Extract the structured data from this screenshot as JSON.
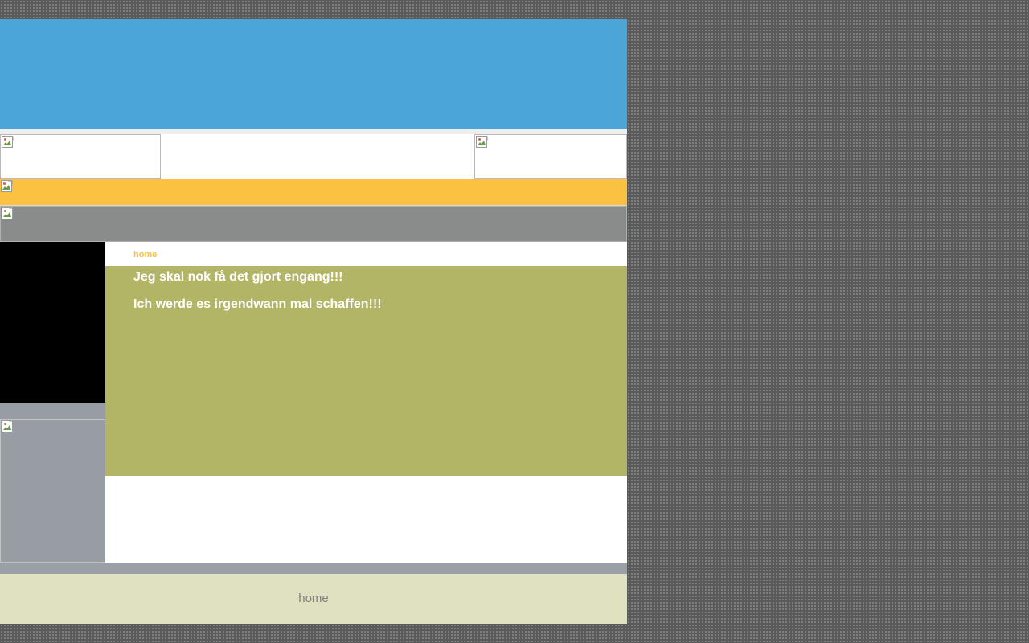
{
  "breadcrumb": {
    "label": "home"
  },
  "content": {
    "line_1": "Jeg skal nok få det gjort engang!!!",
    "line_2": "Ich werde es irgendwann mal schaffen!!!"
  },
  "footer": {
    "link_label": "home"
  },
  "icons": {
    "broken_image": "broken-image-icon"
  },
  "colors": {
    "header_blue": "#4aa6d6",
    "nav_orange": "#fbc141",
    "nav_grey": "#8a8c8b",
    "content_olive": "#b2b466",
    "footer_cream": "#e0e1c1",
    "sidebar_black": "#000000"
  }
}
